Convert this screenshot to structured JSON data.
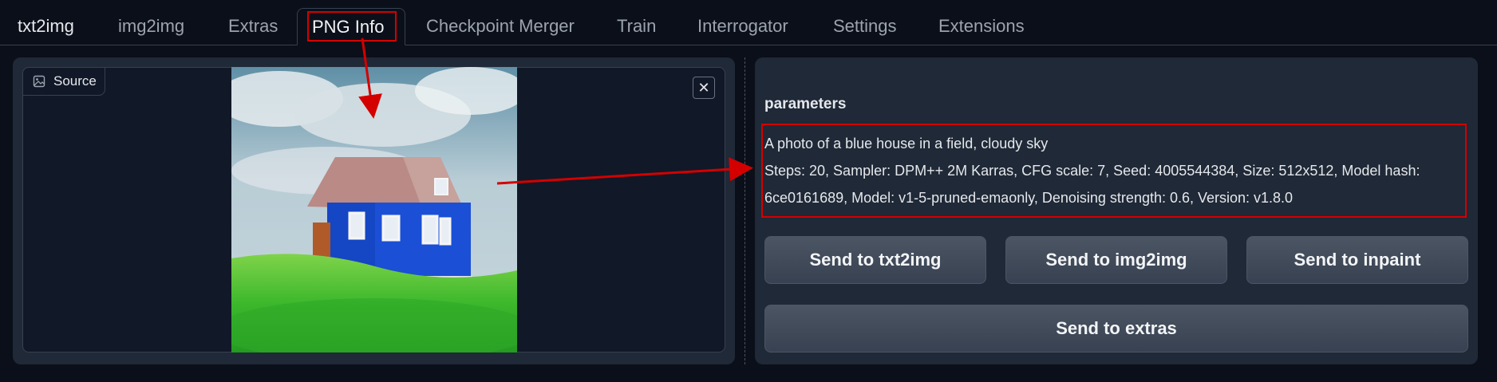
{
  "tabs": [
    {
      "label": "txt2img"
    },
    {
      "label": "img2img"
    },
    {
      "label": "Extras"
    },
    {
      "label": "PNG Info"
    },
    {
      "label": "Checkpoint Merger"
    },
    {
      "label": "Train"
    },
    {
      "label": "Interrogator"
    },
    {
      "label": "Settings"
    },
    {
      "label": "Extensions"
    }
  ],
  "active_tab": "PNG Info",
  "source": {
    "label": "Source",
    "icon": "image-icon",
    "close_symbol": "✕"
  },
  "parameters": {
    "title": "parameters",
    "prompt": "A photo of a blue house in a field, cloudy sky",
    "settings_line1": "Steps: 20, Sampler: DPM++ 2M Karras, CFG scale: 7, Seed: 4005544384, Size: 512x512, Model hash:",
    "settings_line2": "6ce0161689, Model: v1-5-pruned-emaonly, Denoising strength: 0.6, Version: v1.8.0"
  },
  "buttons": {
    "send_txt2img": "Send to txt2img",
    "send_img2img": "Send to img2img",
    "send_inpaint": "Send to inpaint",
    "send_extras": "Send to extras"
  },
  "colors": {
    "background": "#0b0f19",
    "panel": "#1f2937",
    "annotation": "#d40000"
  }
}
